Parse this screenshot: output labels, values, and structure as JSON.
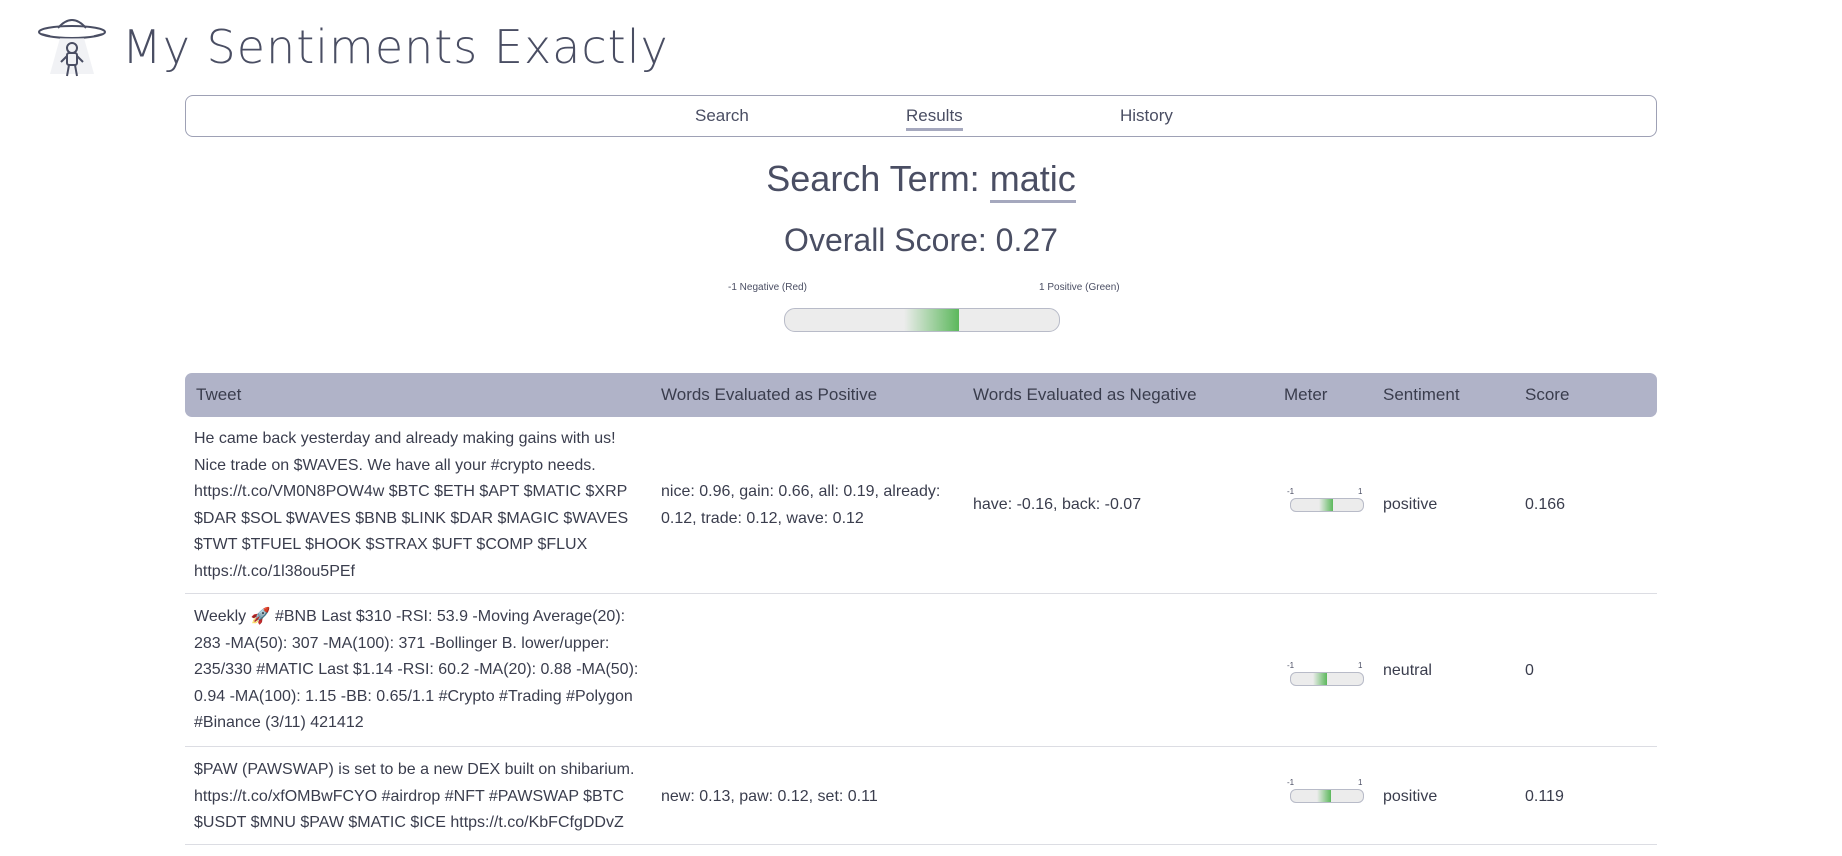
{
  "app": {
    "title": "My Sentiments Exactly",
    "logo_icon": "ufo-astronaut-icon"
  },
  "nav": {
    "items": [
      "Search",
      "Results",
      "History"
    ],
    "active": "Results"
  },
  "search": {
    "label": "Search Term:",
    "term": "matic"
  },
  "overall": {
    "label": "Overall Score:",
    "score_text": "0.27",
    "score": 0.27
  },
  "scale": {
    "negative_label": "-1 Negative (Red)",
    "positive_label": "1 Positive (Green)",
    "min_label": "-1",
    "max_label": "1"
  },
  "colors": {
    "accent": "#a5a8be",
    "header_bg": "#b0b3c8",
    "positive": "#5cb85c",
    "meter_track": "#ececec"
  },
  "table": {
    "columns": [
      "Tweet",
      "Words Evaluated as Positive",
      "Words Evaluated as Negative",
      "Meter",
      "Sentiment",
      "Score"
    ],
    "rows": [
      {
        "tweet": "He came back yesterday and already making gains with us! Nice trade on $WAVES. We have all your #crypto needs. https://t.co/VM0N8POW4w $BTC $ETH $APT $MATIC $XRP $DAR $SOL $WAVES $BNB $LINK $DAR $MAGIC $WAVES $TWT $TFUEL $HOOK $STRAX $UFT $COMP $FLUX https://t.co/1l38ou5PEf",
        "positive_words": "nice: 0.96, gain: 0.66, all: 0.19, already: 0.12, trade: 0.12, wave: 0.12",
        "negative_words": "have: -0.16, back: -0.07",
        "sentiment": "positive",
        "score_text": "0.166",
        "score": 0.166
      },
      {
        "tweet": "Weekly 🚀 #BNB Last $310 -RSI: 53.9 -Moving Average(20): 283 -MA(50): 307 -MA(100): 371 -Bollinger B. lower/upper: 235/330 #MATIC Last $1.14 -RSI: 60.2 -MA(20): 0.88 -MA(50): 0.94 -MA(100): 1.15 -BB: 0.65/1.1 #Crypto #Trading #Polygon #Binance (3/11) 421412",
        "positive_words": "",
        "negative_words": "",
        "sentiment": "neutral",
        "score_text": "0",
        "score": 0
      },
      {
        "tweet": "$PAW (PAWSWAP) is set to be a new DEX built on shibarium. https://t.co/xfOMBwFCYO #airdrop #NFT #PAWSWAP $BTC $USDT $MNU $PAW $MATIC $ICE https://t.co/KbFCfgDDvZ",
        "positive_words": "new: 0.13, paw: 0.12, set: 0.11",
        "negative_words": "",
        "sentiment": "positive",
        "score_text": "0.119",
        "score": 0.119
      }
    ]
  }
}
